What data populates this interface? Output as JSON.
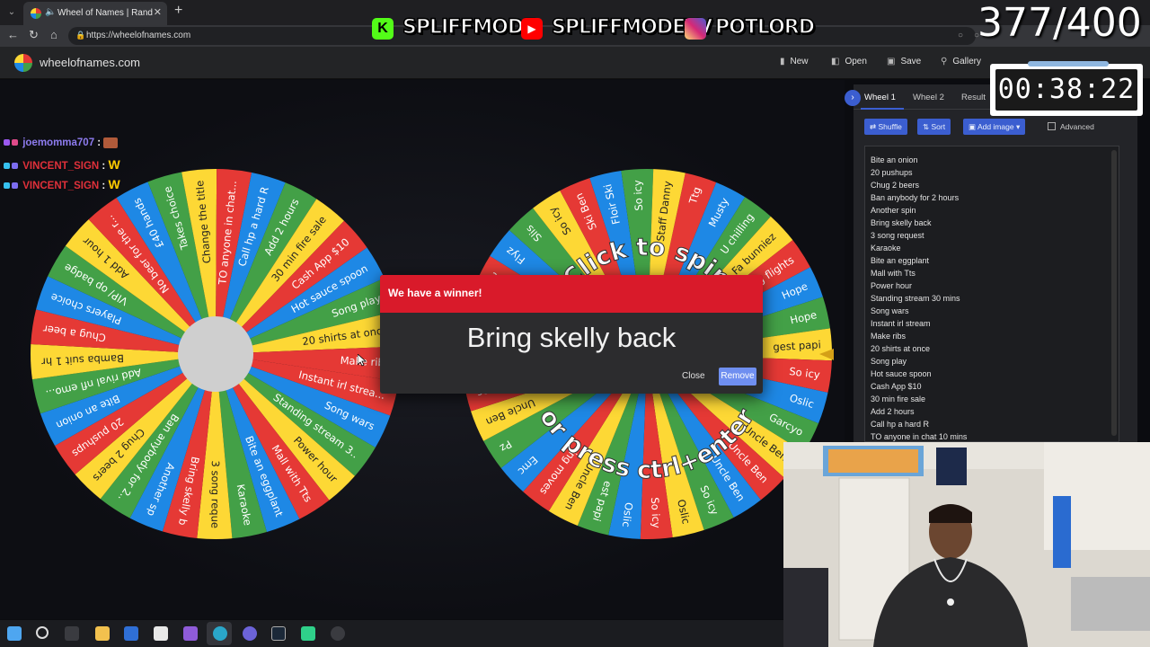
{
  "browser": {
    "tab_title": "Wheel of Names | Random na",
    "url": "https://wheelofnames.com"
  },
  "site": {
    "name": "wheelofnames.com",
    "nav": [
      "New",
      "Open",
      "Save",
      "Gallery"
    ]
  },
  "chat": [
    {
      "user": "joemomma707",
      "color": "#8e7cf0"
    },
    {
      "user": "VINCENT_SIGN",
      "color": "#e0303a"
    },
    {
      "user": "VINCENT_SIGN",
      "color": "#e0303a"
    }
  ],
  "wheel_left": {
    "labels": [
      "Instant irl strea...",
      "Song wars",
      "Standing stream 3..",
      "Power hour",
      "Mall with Tts",
      "Bite an eggplant",
      "Karaoke",
      "3 song reque",
      "Bring skelly b",
      "Another sp",
      "Ban anybody for 2..",
      "Chug 2 beers",
      "20 pushups",
      "Bite an onion",
      "Add rival nfl emo...",
      "Bamba suit 1 hr",
      "Chug a beer",
      "Players choice",
      "VIP/ op badge",
      "Add 1 hour",
      "No beer for the r...",
      "£40 hands",
      "Takes choice",
      "Change the title",
      "TO anyone in chat...",
      "Call hp a hard R",
      "Add 2 hours",
      "30 min fire sale",
      "Cash App $10",
      "Hot sauce spoon",
      "Song play",
      "20 shirts at once",
      "Make ribs"
    ]
  },
  "wheel_right": {
    "spin_text_top": "Click to spin",
    "spin_text_bottom": "or press ctrl+enter",
    "labels": [
      "Ttg",
      "Musty",
      "U chilling",
      "Fa bunniez",
      "ing flights",
      "Hope",
      "Hope",
      "gest papi",
      "So icy",
      "Oslic",
      "Garcyo",
      "Uncle Ben",
      "Uncle Ben",
      "Uncle Ben",
      "So icy",
      "Oslic",
      "So icy",
      "Oslic",
      "est papi",
      "Uncle Ben",
      "ing moves",
      "Emc",
      "Pz",
      "Uncle Ben",
      "Espoc",
      "cle Ben",
      "papi",
      "Catching flights",
      "Emc",
      "Flyz",
      "Slis",
      "So icy",
      "Ski Ben",
      "Floir Ski",
      "So icy",
      "Staff Danny"
    ]
  },
  "dialog": {
    "heading": "We have a winner!",
    "winner": "Bring skelly back",
    "close_label": "Close",
    "remove_label": "Remove"
  },
  "panel": {
    "tabs": [
      "Wheel 1",
      "Wheel 2",
      "Result"
    ],
    "buttons": [
      "Shuffle",
      "Sort",
      "Add image"
    ],
    "advanced_label": "Advanced",
    "entries": [
      "Bite an onion",
      "20 pushups",
      "Chug 2 beers",
      "Ban anybody for 2 hours",
      "Another spin",
      "Bring skelly back",
      "3 song request",
      "Karaoke",
      "Bite an eggplant",
      "Mall with Tts",
      "Power hour",
      "Standing stream 30 mins",
      "Song wars",
      "Instant irl stream",
      "Make ribs",
      "20 shirts at once",
      "Song play",
      "Hot sauce spoon",
      "Cash App $10",
      "30 min fire sale",
      "Add 2 hours",
      "Call hp a hard R",
      "TO anyone in chat 10 mins"
    ]
  },
  "overlay": {
    "socials": [
      {
        "name": "SPLIFFMODE",
        "icon": "kick-icon",
        "color": "#53fc18"
      },
      {
        "name": "SPLIFFMODETV",
        "icon": "youtube-icon",
        "color": "#ff0000"
      },
      {
        "name": "POTLORD",
        "icon": "instagram-icon",
        "color": "#d62976"
      }
    ],
    "counter": "377/400",
    "timer": "00:38:22"
  },
  "colors": {
    "segments": [
      "#e53935",
      "#1e88e5",
      "#43a047",
      "#fdd835"
    ],
    "accent": "#3b5ed0",
    "dialog_header": "#d91a2a"
  }
}
